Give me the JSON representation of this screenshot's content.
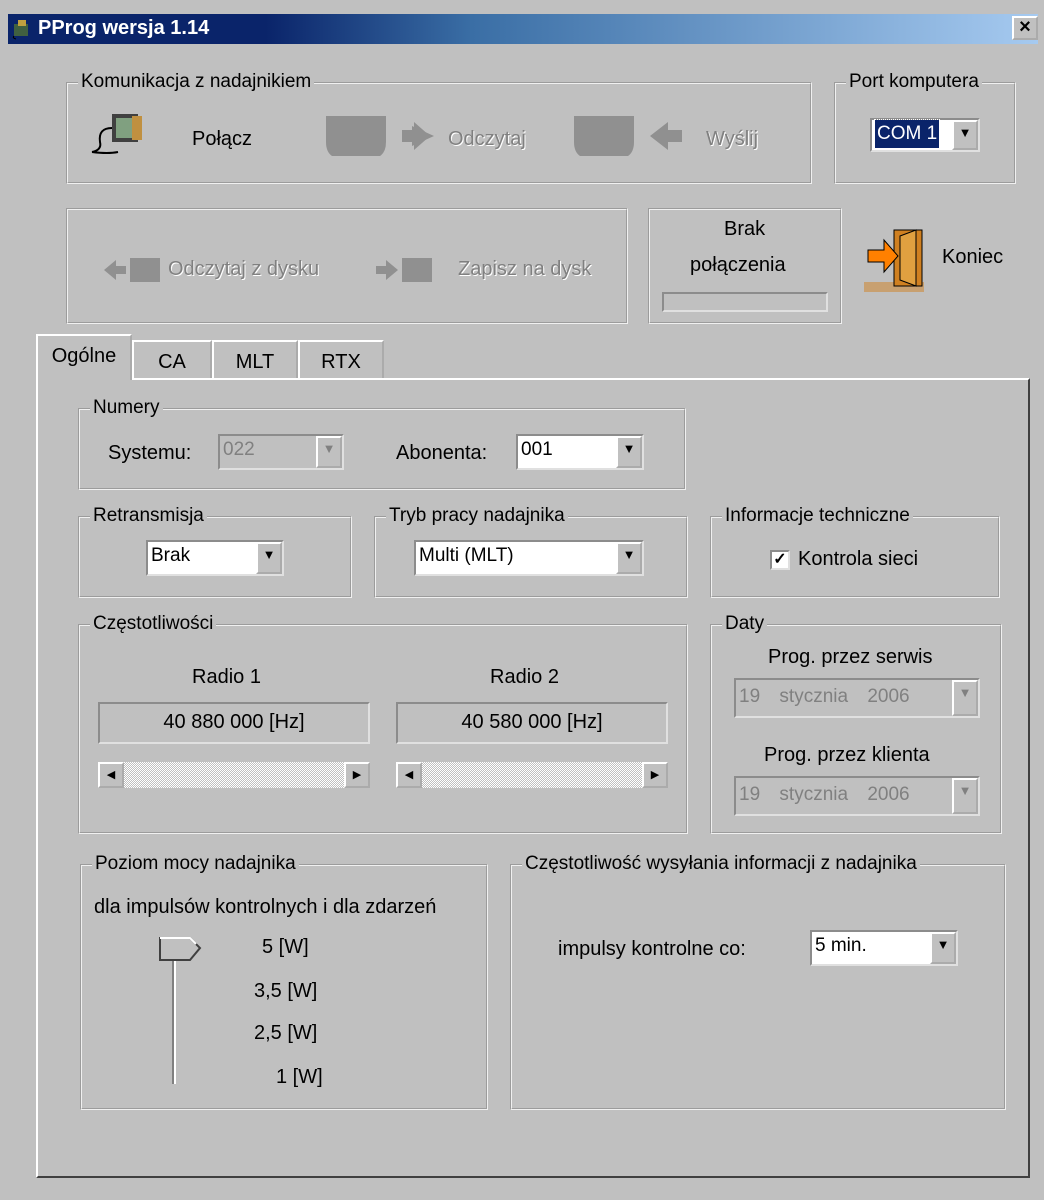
{
  "window": {
    "title": "PProg wersja 1.14",
    "close": "×"
  },
  "communication": {
    "legend": "Komunikacja z nadajnikiem",
    "connect": "Połącz",
    "read": "Odczytaj",
    "send": "Wyślij"
  },
  "port": {
    "legend": "Port komputera",
    "value": "COM 1"
  },
  "disk": {
    "read": "Odczytaj z dysku",
    "save": "Zapisz na dysk"
  },
  "status": {
    "line1": "Brak",
    "line2": "połączenia",
    "progress": 0
  },
  "exit": {
    "label": "Koniec"
  },
  "tabs": [
    {
      "label": "Ogólne"
    },
    {
      "label": "CA"
    },
    {
      "label": "MLT"
    },
    {
      "label": "RTX"
    }
  ],
  "numbers": {
    "legend": "Numery",
    "system_label": "Systemu:",
    "system_value": "022",
    "subscriber_label": "Abonenta:",
    "subscriber_value": "001"
  },
  "retransmission": {
    "legend": "Retransmisja",
    "value": "Brak"
  },
  "mode": {
    "legend": "Tryb pracy nadajnika",
    "value": "Multi (MLT)"
  },
  "tech": {
    "legend": "Informacje techniczne",
    "checkbox_label": "Kontrola sieci",
    "checked": true
  },
  "frequencies": {
    "legend": "Częstotliwości",
    "radio1_label": "Radio 1",
    "radio1_value": "40 880 000 [Hz]",
    "radio2_label": "Radio 2",
    "radio2_value": "40 580 000 [Hz]"
  },
  "dates": {
    "legend": "Daty",
    "service_label": "Prog. przez serwis",
    "service_day": "19",
    "service_month": "stycznia",
    "service_year": "2006",
    "client_label": "Prog. przez klienta",
    "client_day": "19",
    "client_month": "stycznia",
    "client_year": "2006"
  },
  "power": {
    "legend": "Poziom mocy nadajnika",
    "subtitle": "dla impulsów kontrolnych i dla zdarzeń",
    "levels": [
      "5 [W]",
      "3,5 [W]",
      "2,5 [W]",
      "1 [W]"
    ],
    "selected": "5 [W]"
  },
  "send_freq": {
    "legend": "Częstotliwość wysyłania informacji z nadajnika",
    "label": "impulsy kontrolne co:",
    "value": "5 min."
  }
}
